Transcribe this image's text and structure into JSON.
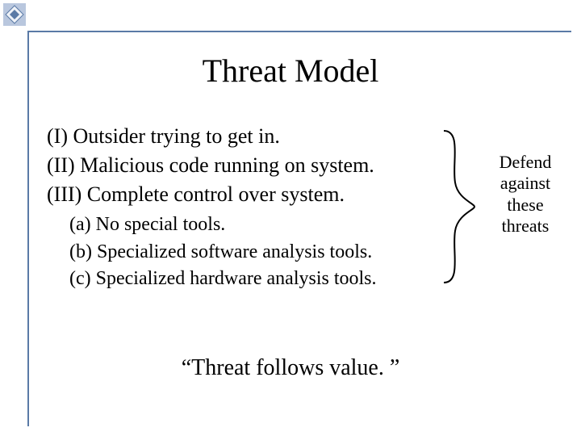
{
  "title": "Threat Model",
  "items": [
    "(I) Outsider trying to get in.",
    "(II) Malicious code running on system.",
    "(III) Complete control over system."
  ],
  "subitems": [
    "(a) No special tools.",
    "(b) Specialized software analysis tools.",
    "(c) Specialized hardware analysis tools."
  ],
  "annotation": {
    "line1": "Defend",
    "line2": "against",
    "line3": "these",
    "line4": "threats"
  },
  "quote": "“Threat follows value. ”"
}
